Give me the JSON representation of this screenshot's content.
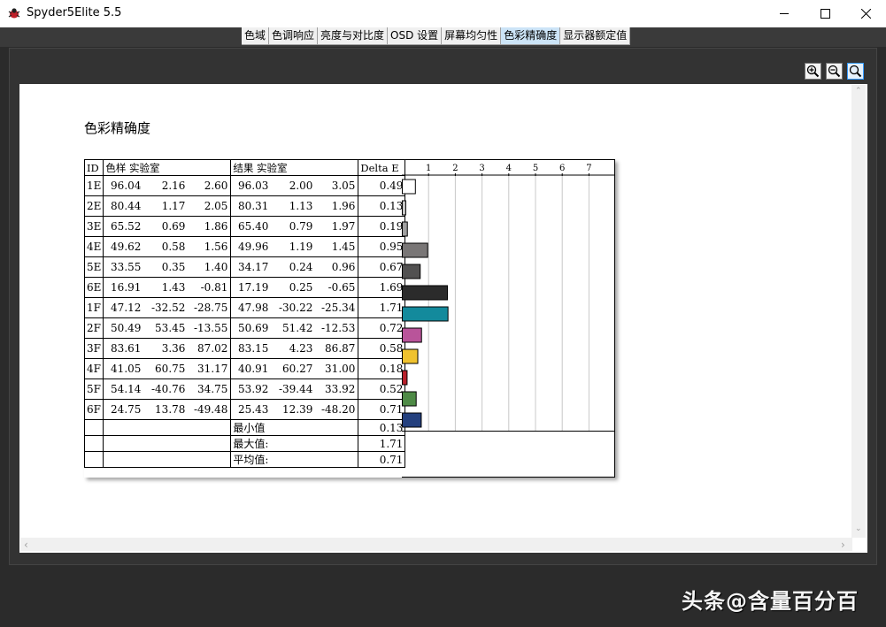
{
  "window": {
    "title": "Spyder5Elite 5.5"
  },
  "tabs": [
    {
      "label": "色域",
      "active": false
    },
    {
      "label": "色调响应",
      "active": false
    },
    {
      "label": "亮度与对比度",
      "active": false
    },
    {
      "label": "OSD 设置",
      "active": false
    },
    {
      "label": "屏幕均匀性",
      "active": false
    },
    {
      "label": "色彩精确度",
      "active": true
    },
    {
      "label": "显示器额定值",
      "active": false
    }
  ],
  "report": {
    "title": "色彩精确度",
    "headers": {
      "id": "ID",
      "sample": "色样 实验室",
      "result": "结果 实验室",
      "delta": "Delta E"
    },
    "rows": [
      {
        "id": "1E",
        "s": [
          "96.04",
          "2.16",
          "2.60"
        ],
        "r": [
          "96.03",
          "2.00",
          "3.05"
        ],
        "de": "0.49",
        "color": "#ffffff"
      },
      {
        "id": "2E",
        "s": [
          "80.44",
          "1.17",
          "2.05"
        ],
        "r": [
          "80.31",
          "1.13",
          "1.96"
        ],
        "de": "0.13",
        "color": "#c8c8c8"
      },
      {
        "id": "3E",
        "s": [
          "65.52",
          "0.69",
          "1.86"
        ],
        "r": [
          "65.40",
          "0.79",
          "1.97"
        ],
        "de": "0.19",
        "color": "#a0a0a0"
      },
      {
        "id": "4E",
        "s": [
          "49.62",
          "0.58",
          "1.56"
        ],
        "r": [
          "49.96",
          "1.19",
          "1.45"
        ],
        "de": "0.95",
        "color": "#797676"
      },
      {
        "id": "5E",
        "s": [
          "33.55",
          "0.35",
          "1.40"
        ],
        "r": [
          "34.17",
          "0.24",
          "0.96"
        ],
        "de": "0.67",
        "color": "#525151"
      },
      {
        "id": "6E",
        "s": [
          "16.91",
          "1.43",
          "-0.81"
        ],
        "r": [
          "17.19",
          "0.25",
          "-0.65"
        ],
        "de": "1.69",
        "color": "#2b2b2b"
      },
      {
        "id": "1F",
        "s": [
          "47.12",
          "-32.52",
          "-28.75"
        ],
        "r": [
          "47.98",
          "-30.22",
          "-25.34"
        ],
        "de": "1.71",
        "color": "#138a9c"
      },
      {
        "id": "2F",
        "s": [
          "50.49",
          "53.45",
          "-13.55"
        ],
        "r": [
          "50.69",
          "51.42",
          "-12.53"
        ],
        "de": "0.72",
        "color": "#b9549a"
      },
      {
        "id": "3F",
        "s": [
          "83.61",
          "3.36",
          "87.02"
        ],
        "r": [
          "83.15",
          "4.23",
          "86.87"
        ],
        "de": "0.58",
        "color": "#f0c22e"
      },
      {
        "id": "4F",
        "s": [
          "41.05",
          "60.75",
          "31.17"
        ],
        "r": [
          "40.91",
          "60.27",
          "31.00"
        ],
        "de": "0.18",
        "color": "#b8202a"
      },
      {
        "id": "5F",
        "s": [
          "54.14",
          "-40.76",
          "34.75"
        ],
        "r": [
          "53.92",
          "-39.44",
          "33.92"
        ],
        "de": "0.52",
        "color": "#4e8a46"
      },
      {
        "id": "6F",
        "s": [
          "24.75",
          "13.78",
          "-49.48"
        ],
        "r": [
          "25.43",
          "12.39",
          "-48.20"
        ],
        "de": "0.71",
        "color": "#24407e"
      }
    ],
    "summary": [
      {
        "label": "最小值",
        "value": "0.13"
      },
      {
        "label": "最大值:",
        "value": "1.71"
      },
      {
        "label": "平均值:",
        "value": "0.71"
      }
    ],
    "chart_ticks": [
      "1",
      "2",
      "3",
      "4",
      "5",
      "6",
      "7"
    ]
  },
  "watermark": "头条@含量百分百"
}
